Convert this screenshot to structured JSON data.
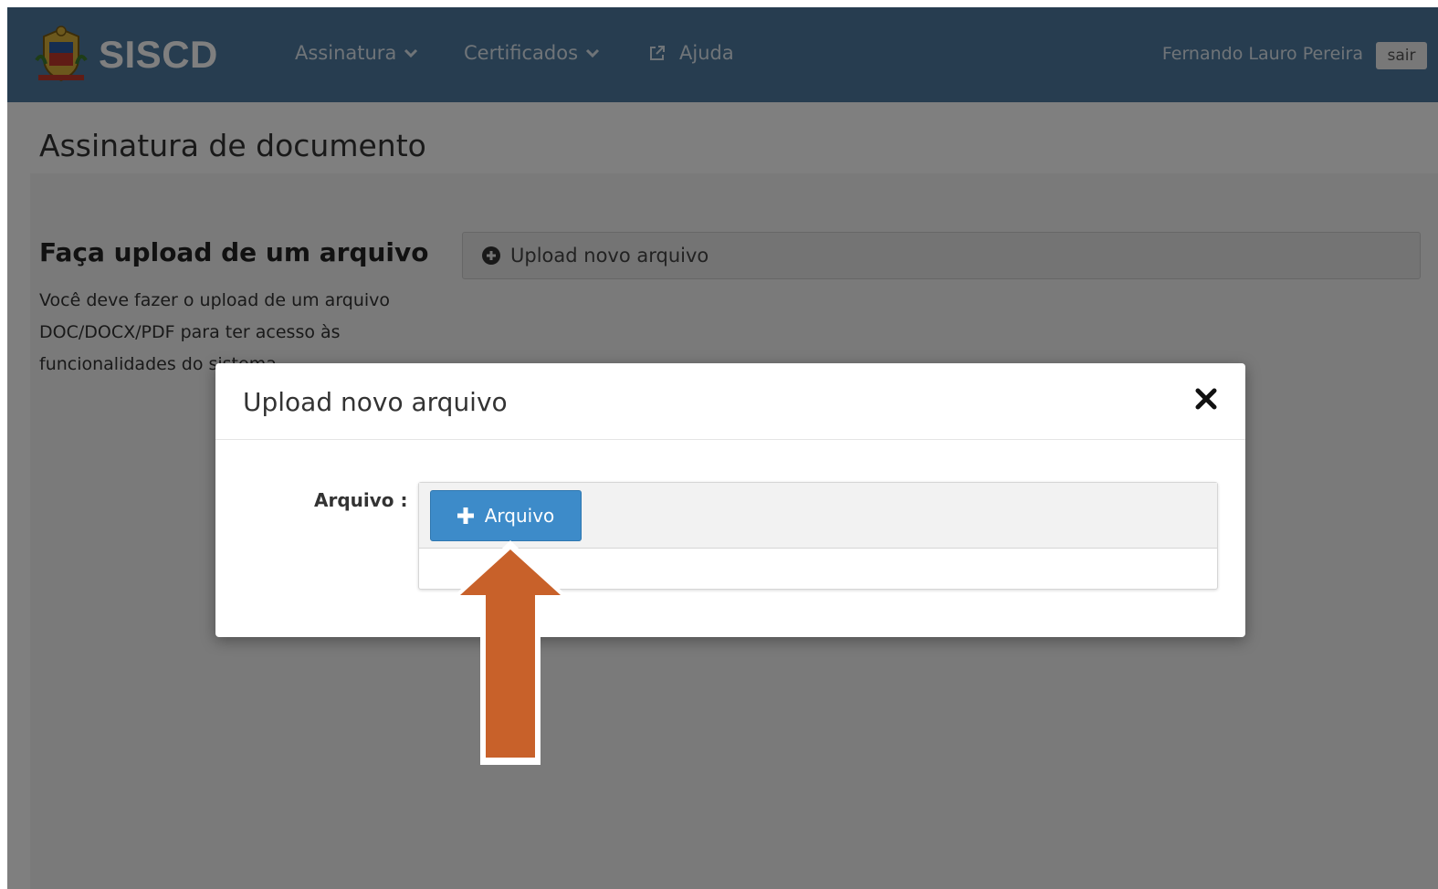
{
  "navbar": {
    "brand": "SISCD",
    "menu": [
      {
        "label": "Assinatura",
        "dropdown": true
      },
      {
        "label": "Certificados",
        "dropdown": true
      },
      {
        "label": "Ajuda",
        "external": true
      }
    ],
    "user_name": "Fernando Lauro Pereira",
    "logout_label": "sair"
  },
  "page": {
    "title": "Assinatura de documento",
    "section_title": "Faça upload de um arquivo",
    "section_desc": "Você deve fazer o upload de um arquivo DOC/DOCX/PDF para ter acesso às funcionalidades do sistema.",
    "upload_button_label": "Upload novo arquivo"
  },
  "modal": {
    "title": "Upload novo arquivo",
    "field_label": "Arquivo :",
    "file_button_label": "Arquivo",
    "close_icon": "close-icon"
  },
  "colors": {
    "navbar": "#4e7aa0",
    "primary_button": "#3d8bc9",
    "annotation_arrow": "#c8612a"
  }
}
